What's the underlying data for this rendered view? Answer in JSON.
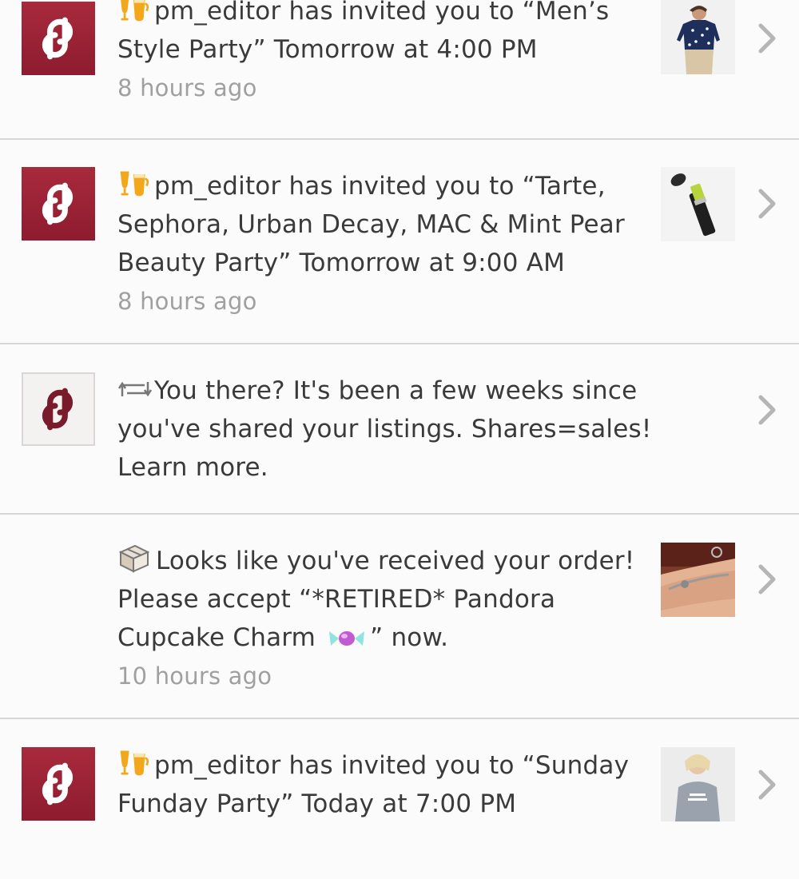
{
  "notifications": [
    {
      "icon": "party-cups-icon",
      "message": "pm_editor has invited you to “Men’s Style Party” Tomorrow at 4:00 PM",
      "time": "8 hours ago",
      "avatar_style": "brand",
      "thumbnail": "mens-shirt-photo"
    },
    {
      "icon": "party-cups-icon",
      "message": "pm_editor has invited you to “Tarte, Sephora, Urban Decay, MAC & Mint Pear Beauty Party” Tomorrow at 9:00 AM",
      "time": "8 hours ago",
      "avatar_style": "brand",
      "thumbnail": "lipstick-photo"
    },
    {
      "icon": "share-arrows-icon",
      "message": "You there? It's been a few weeks since you've shared your listings. Shares=sales! Learn more.",
      "time": "",
      "avatar_style": "light",
      "thumbnail": ""
    },
    {
      "icon": "package-box-icon",
      "message_before_emoji": "Looks like you've received your order! Please accept “*RETIRED* Pandora Cupcake Charm",
      "emoji": "candy-icon",
      "message_after_emoji": "” now.",
      "time": "10 hours ago",
      "avatar_style": "none",
      "thumbnail": "bracelet-photo"
    },
    {
      "icon": "party-cups-icon",
      "message": "pm_editor has invited you to “Sunday Funday Party” Today at 7:00 PM",
      "time": "",
      "avatar_style": "brand",
      "thumbnail": "sweatshirt-photo"
    }
  ],
  "colors": {
    "brand": "#9b2235",
    "text": "#3a3a3a",
    "timestamp": "#a0a0a0",
    "divider": "#d6d6d6",
    "chevron": "#b5b5b5"
  }
}
